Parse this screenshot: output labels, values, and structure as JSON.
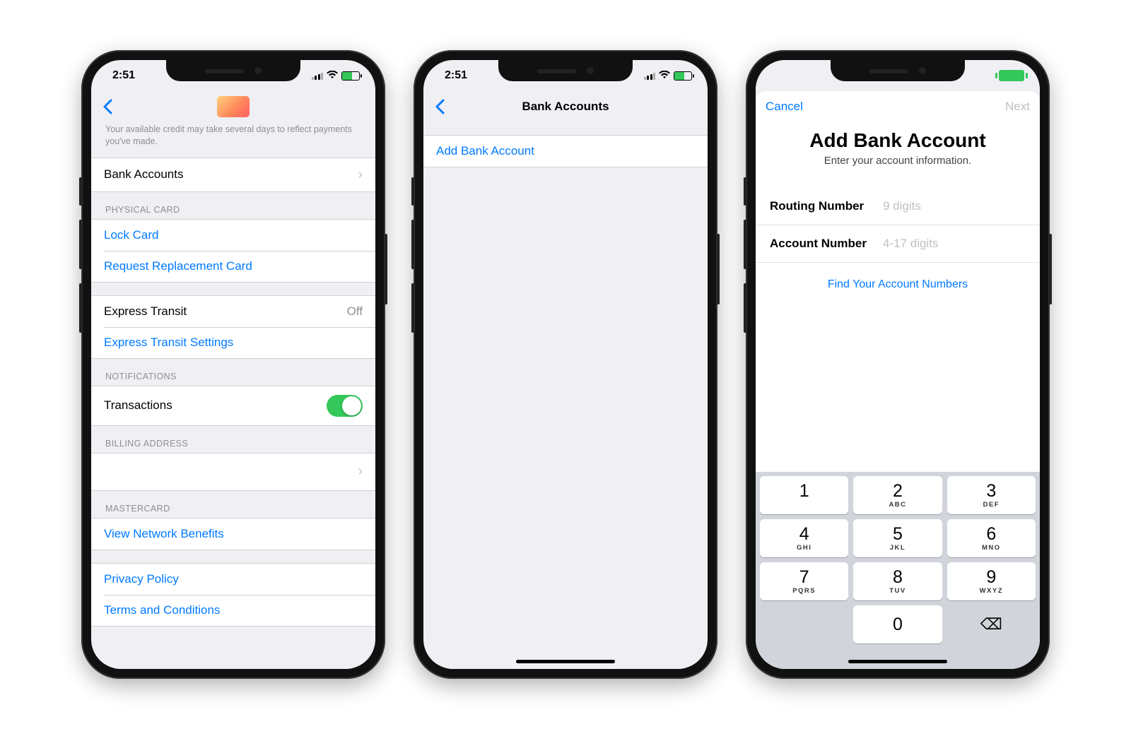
{
  "status": {
    "time": "2:51"
  },
  "screen1": {
    "credit_note": "Your available credit may take several days to reflect payments you've made.",
    "bank_accounts_label": "Bank Accounts",
    "physical_card_header": "PHYSICAL CARD",
    "lock_card_label": "Lock Card",
    "request_replacement_label": "Request Replacement Card",
    "express_transit_label": "Express Transit",
    "express_transit_value": "Off",
    "express_transit_settings_label": "Express Transit Settings",
    "notifications_header": "NOTIFICATIONS",
    "transactions_label": "Transactions",
    "billing_header": "BILLING ADDRESS",
    "mastercard_header": "MASTERCARD",
    "view_benefits_label": "View Network Benefits",
    "privacy_label": "Privacy Policy",
    "terms_label": "Terms and Conditions"
  },
  "screen2": {
    "title": "Bank Accounts",
    "add_label": "Add Bank Account"
  },
  "screen3": {
    "cancel_label": "Cancel",
    "next_label": "Next",
    "title": "Add Bank Account",
    "subtitle": "Enter your account information.",
    "routing_label": "Routing Number",
    "routing_placeholder": "9 digits",
    "account_label": "Account Number",
    "account_placeholder": "4-17 digits",
    "help_label": "Find Your Account Numbers",
    "keys": {
      "k1": "1",
      "k2": "2",
      "k3": "3",
      "k4": "4",
      "k5": "5",
      "k6": "6",
      "k7": "7",
      "k8": "8",
      "k9": "9",
      "k0": "0",
      "l2": "ABC",
      "l3": "DEF",
      "l4": "GHI",
      "l5": "JKL",
      "l6": "MNO",
      "l7": "PQRS",
      "l8": "TUV",
      "l9": "WXYZ",
      "del": "⌫"
    }
  }
}
